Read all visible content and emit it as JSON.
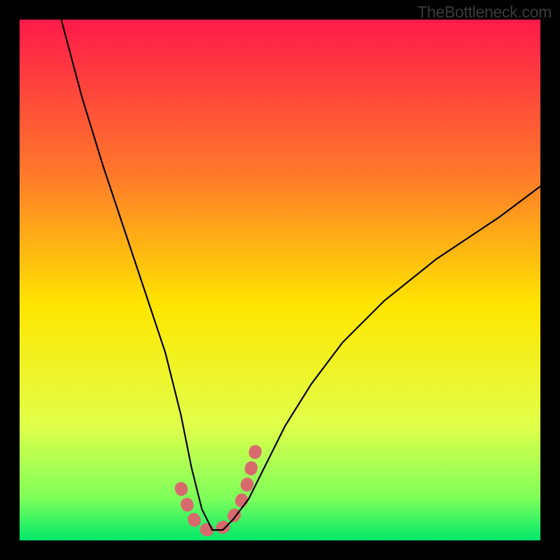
{
  "attribution": "TheBottleneck.com",
  "chart_data": {
    "type": "line",
    "title": "",
    "xlabel": "",
    "ylabel": "",
    "xlim": [
      0,
      100
    ],
    "ylim": [
      0,
      100
    ],
    "gradient_colors": {
      "top": "#ff1a4a",
      "upper_mid": "#ff7a2a",
      "mid": "#ffe600",
      "lower_mid": "#e0ff4a",
      "low": "#7dff5a",
      "bottom": "#00e86a"
    },
    "series": [
      {
        "name": "bottleneck-curve",
        "x": [
          8,
          12,
          16,
          20,
          24,
          28,
          31,
          33,
          35,
          37,
          39,
          41,
          44,
          47,
          51,
          56,
          62,
          70,
          80,
          92,
          100
        ],
        "y": [
          100,
          85,
          72,
          60,
          48,
          36,
          24,
          14,
          6,
          2,
          2,
          4,
          8,
          14,
          22,
          30,
          38,
          46,
          54,
          62,
          68
        ]
      }
    ],
    "valley_markers": {
      "name": "valley-accent",
      "x": [
        31,
        32.5,
        34,
        36,
        38,
        40,
        42,
        43.5,
        44.5,
        45.5
      ],
      "y": [
        10,
        6,
        3,
        2,
        2,
        3,
        6,
        10,
        14,
        18
      ],
      "color": "#d86a6e",
      "stroke_width": 10
    }
  }
}
